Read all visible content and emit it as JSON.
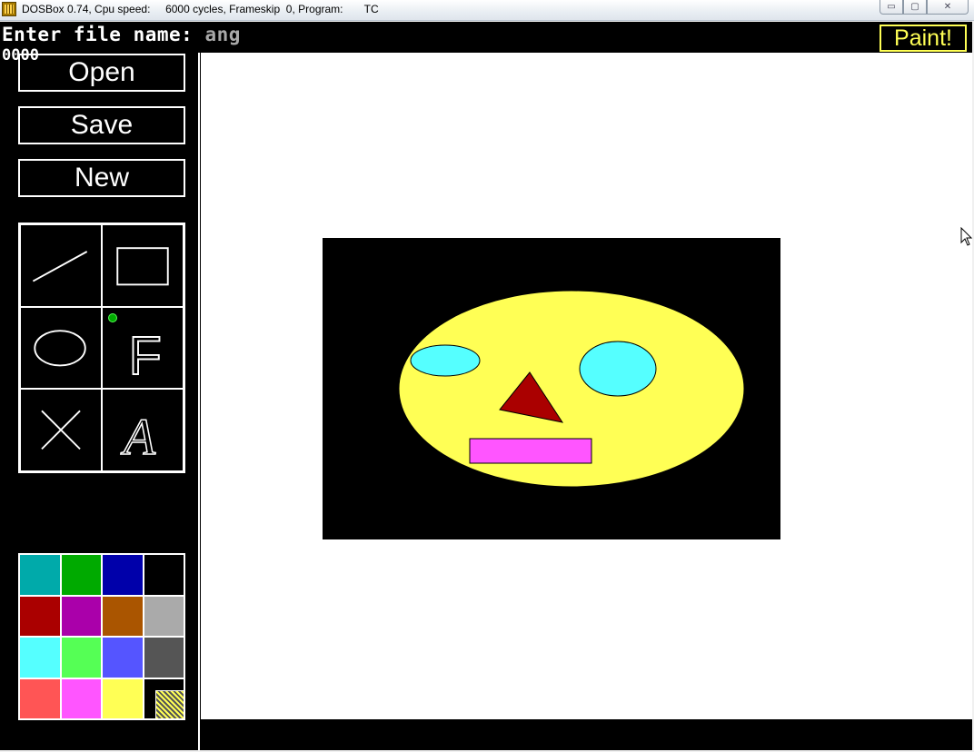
{
  "window": {
    "title": "DOSBox 0.74, Cpu speed:     6000 cycles, Frameskip  0, Program:       TC",
    "minimize_label": "▭",
    "maximize_label": "▢",
    "close_label": "✕"
  },
  "prompt": {
    "label": "Enter file name: ",
    "value": "ang"
  },
  "coords": "0000",
  "brand": "Paint!",
  "file_buttons": {
    "open": "Open",
    "save": "Save",
    "new": "New"
  },
  "tools": [
    {
      "name": "line-tool",
      "icon": "line-icon"
    },
    {
      "name": "rectangle-tool",
      "icon": "rectangle-icon"
    },
    {
      "name": "ellipse-tool",
      "icon": "ellipse-icon"
    },
    {
      "name": "fill-tool",
      "icon": "fill-letter-icon",
      "glyph": "F",
      "selected": true
    },
    {
      "name": "eraser-tool",
      "icon": "cross-icon"
    },
    {
      "name": "text-tool",
      "icon": "letter-a-icon",
      "glyph": "A"
    }
  ],
  "palette": [
    "#00aaaa",
    "#00aa00",
    "#0000aa",
    "#000000",
    "#aa0000",
    "#aa00aa",
    "#aa5500",
    "#aaaaaa",
    "#55ffff",
    "#55ff55",
    "#5555ff",
    "#555555",
    "#ff5555",
    "#ff55ff",
    "#ffff55"
  ],
  "current_color": "#ffff55",
  "drawing": {
    "background": "#000000",
    "face": "#ffff55",
    "eyes": "#55ffff",
    "nose": "#aa0000",
    "mouth": "#ff55ff"
  }
}
